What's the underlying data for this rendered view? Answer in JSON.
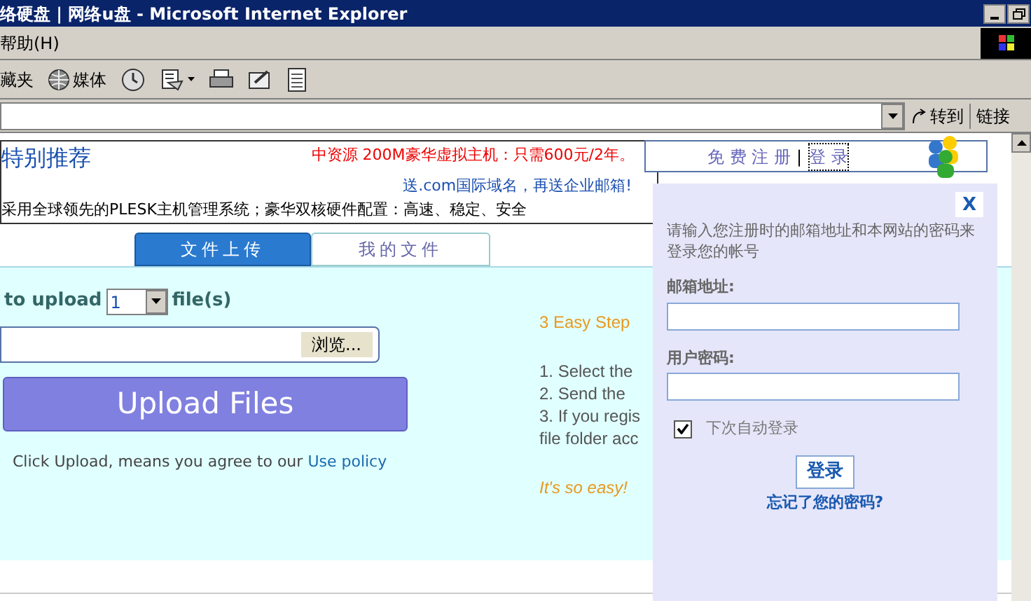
{
  "window": {
    "title": "络硬盘 | 网络u盘 - Microsoft Internet Explorer"
  },
  "menu": {
    "items": [
      "帮助(H)"
    ]
  },
  "toolbar": {
    "items": [
      {
        "kind": "text",
        "label": "藏夹"
      },
      {
        "kind": "media",
        "label": "媒体"
      },
      {
        "kind": "history"
      },
      {
        "kind": "mail"
      },
      {
        "kind": "print"
      },
      {
        "kind": "edit"
      },
      {
        "kind": "discuss"
      }
    ]
  },
  "address_bar": {
    "go": "转到",
    "links": "链接"
  },
  "ad": {
    "title": "特别推荐",
    "line_1": "中资源 200M豪华虚拟主机：只需600元/2年。",
    "line_2": "送.com国际域名，再送企业邮箱!",
    "line_3": "采用全球领先的PLESK主机管理系统；豪华双核硬件配置：高速、稳定、安全"
  },
  "account": {
    "register": "免 费 注 册",
    "separator": "|",
    "login": "登 录"
  },
  "tabs": [
    {
      "label": "文件上传",
      "selected": true
    },
    {
      "label": "我的文件",
      "selected": false
    }
  ],
  "upload": {
    "prefix": "to upload",
    "count": "1",
    "suffix": "file(s)",
    "browse": "浏览...",
    "button": "Upload Files",
    "note": "Click Upload, means you agree to our",
    "policy": "Use policy"
  },
  "steps": {
    "title": "3 Easy Step",
    "items": [
      "1. Select the",
      "2. Send the",
      "3. If you regis",
      "file folder acc"
    ],
    "footer": "It's so easy!"
  },
  "login_popup": {
    "close": "X",
    "intro": "请输入您注册时的邮箱地址和本网站的密码来登录您的帐号",
    "email_label": "邮箱地址:",
    "password_label": "用户密码:",
    "remember": {
      "label": "下次自动登录",
      "checked": true
    },
    "submit": "登录",
    "forgot": "忘记了您的密码?"
  }
}
